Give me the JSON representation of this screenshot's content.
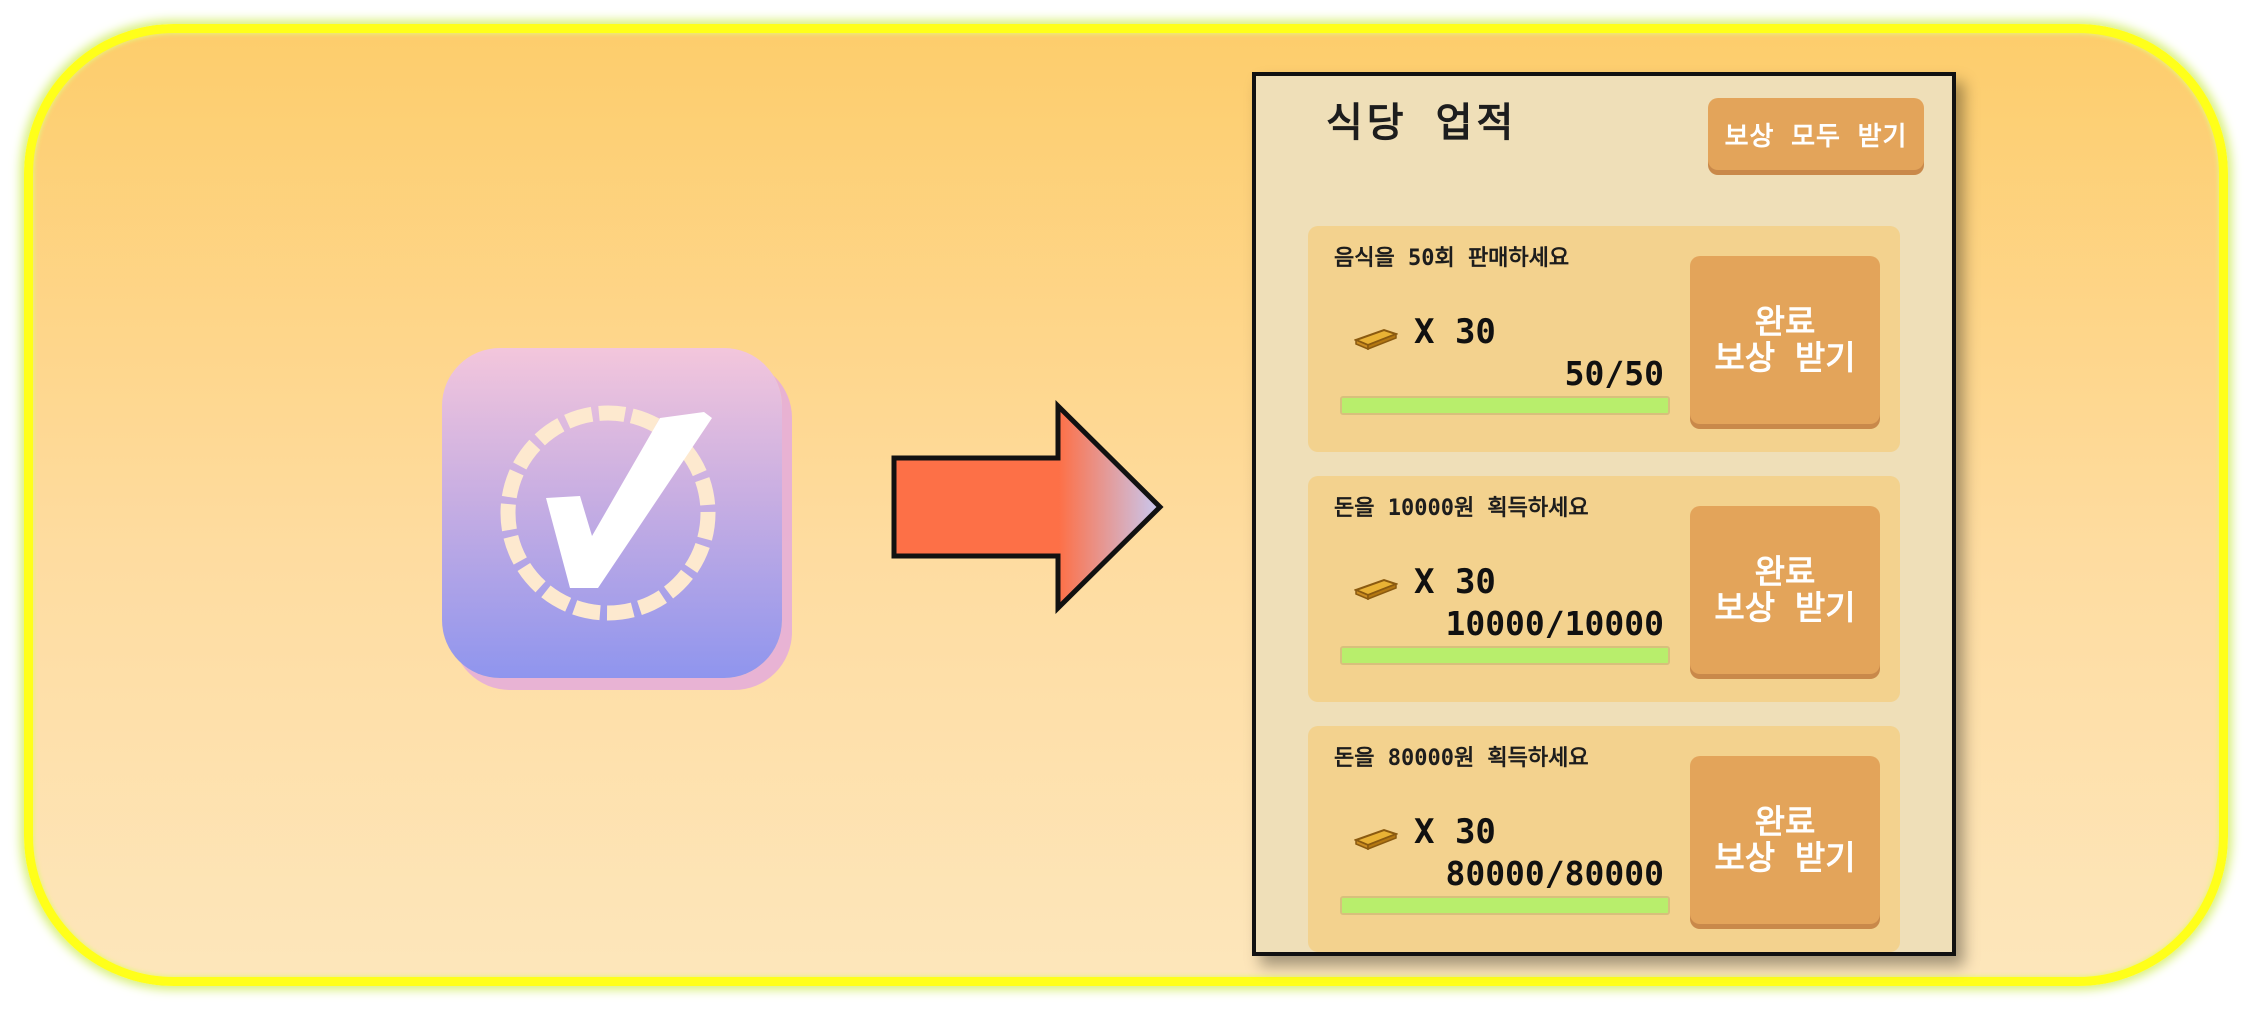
{
  "app_icon": {
    "name": "checkmark-icon"
  },
  "arrow": {
    "name": "right-arrow"
  },
  "panel": {
    "title": "식당 업적",
    "claim_all_label": "보상 모두 받기",
    "achievements": [
      {
        "title": "음식을 50회 판매하세요",
        "reward": "X 30",
        "progress": "50/50",
        "fill": 1.0,
        "btn_line1": "완료",
        "btn_line2": "보상 받기"
      },
      {
        "title": "돈을 10000원 획득하세요",
        "reward": "X 30",
        "progress": "10000/10000",
        "fill": 1.0,
        "btn_line1": "완료",
        "btn_line2": "보상 받기"
      },
      {
        "title": "돈을 80000원 획득하세요",
        "reward": "X 30",
        "progress": "80000/80000",
        "fill": 1.0,
        "btn_line1": "완료",
        "btn_line2": "보상 받기"
      }
    ]
  },
  "colors": {
    "frame_border": "#ffff1a",
    "panel_bg": "#efdfb8",
    "card_bg": "#f3d28e",
    "button": "#e3a45a",
    "progress": "#b8ee6c",
    "arrow": "#fd7047"
  }
}
